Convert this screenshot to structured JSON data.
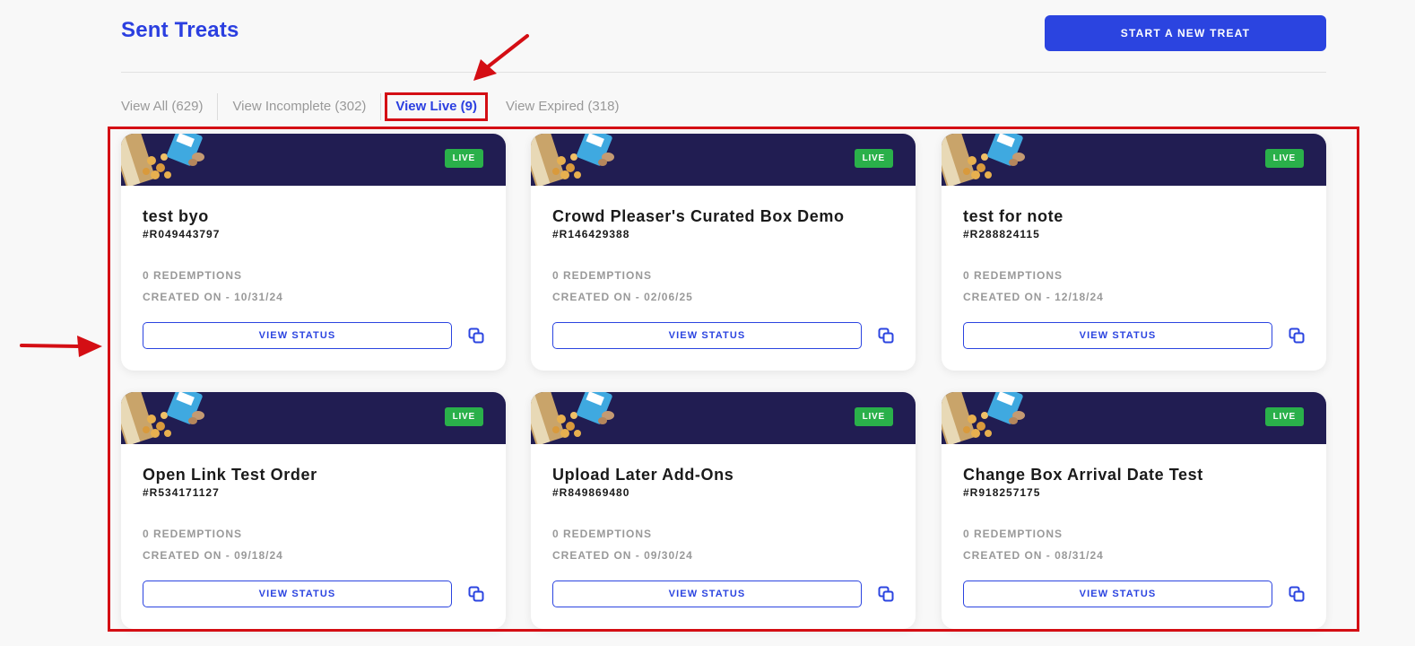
{
  "header": {
    "title": "Sent Treats",
    "start_button": "START A NEW TREAT"
  },
  "tabs": [
    {
      "label": "View All (629)"
    },
    {
      "label": "View Incomplete (302)"
    },
    {
      "label": "View Live (9)"
    },
    {
      "label": "View Expired (318)"
    }
  ],
  "card_common": {
    "badge": "LIVE",
    "view_status": "VIEW STATUS"
  },
  "cards": [
    {
      "title": "test byo",
      "id": "#R049443797",
      "redemptions": "0 REDEMPTIONS",
      "created": "CREATED ON - 10/31/24"
    },
    {
      "title": "Crowd Pleaser's Curated Box Demo",
      "id": "#R146429388",
      "redemptions": "0 REDEMPTIONS",
      "created": "CREATED ON - 02/06/25"
    },
    {
      "title": "test for note",
      "id": "#R288824115",
      "redemptions": "0 REDEMPTIONS",
      "created": "CREATED ON - 12/18/24"
    },
    {
      "title": "Open Link Test Order",
      "id": "#R534171127",
      "redemptions": "0 REDEMPTIONS",
      "created": "CREATED ON - 09/18/24"
    },
    {
      "title": "Upload Later Add-Ons",
      "id": "#R849869480",
      "redemptions": "0 REDEMPTIONS",
      "created": "CREATED ON - 09/30/24"
    },
    {
      "title": "Change Box Arrival Date Test",
      "id": "#R918257175",
      "redemptions": "0 REDEMPTIONS",
      "created": "CREATED ON - 08/31/24"
    }
  ],
  "colors": {
    "accent": "#2b44e0",
    "banner": "#211d52",
    "live": "#2ab04a",
    "annotation": "#d40e14"
  }
}
